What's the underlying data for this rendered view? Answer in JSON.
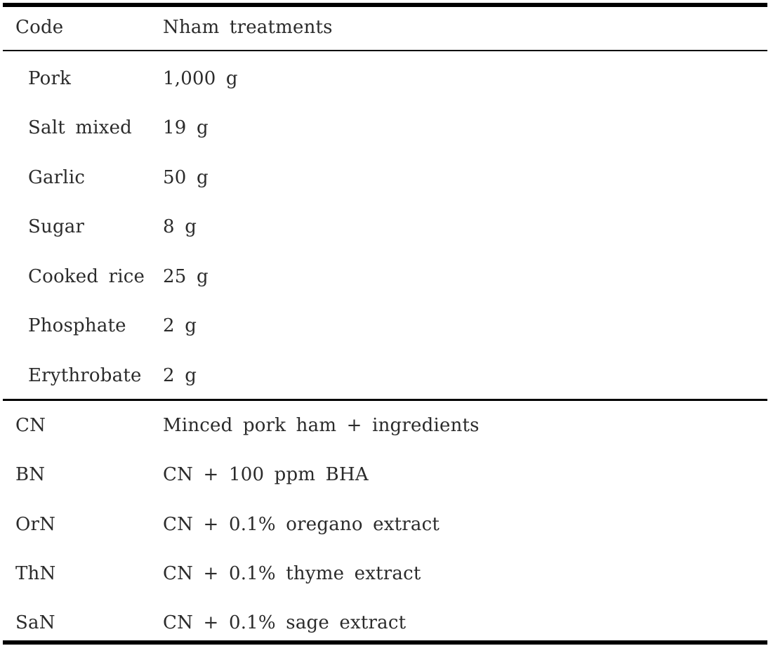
{
  "table": {
    "header": {
      "col1": "Code",
      "col2": "Nham treatments"
    },
    "ingredients": [
      {
        "code": "Pork",
        "value": "1,000 g"
      },
      {
        "code": "Salt mixed",
        "value": "19 g"
      },
      {
        "code": "Garlic",
        "value": "50 g"
      },
      {
        "code": "Sugar",
        "value": "8 g"
      },
      {
        "code": "Cooked rice",
        "value": "25 g"
      },
      {
        "code": "Phosphate",
        "value": "2 g"
      },
      {
        "code": "Erythrobate",
        "value": "2 g"
      }
    ],
    "treatments": [
      {
        "code": "CN",
        "value": "Minced pork ham + ingredients"
      },
      {
        "code": "BN",
        "value": "CN + 100 ppm BHA"
      },
      {
        "code": "OrN",
        "value": "CN + 0.1% oregano extract"
      },
      {
        "code": "ThN",
        "value": "CN + 0.1% thyme extract"
      },
      {
        "code": "SaN",
        "value": "CN + 0.1% sage extract"
      }
    ],
    "colors": {
      "text": "#2b2b2b",
      "rule": "#000000",
      "background": "#ffffff"
    }
  }
}
